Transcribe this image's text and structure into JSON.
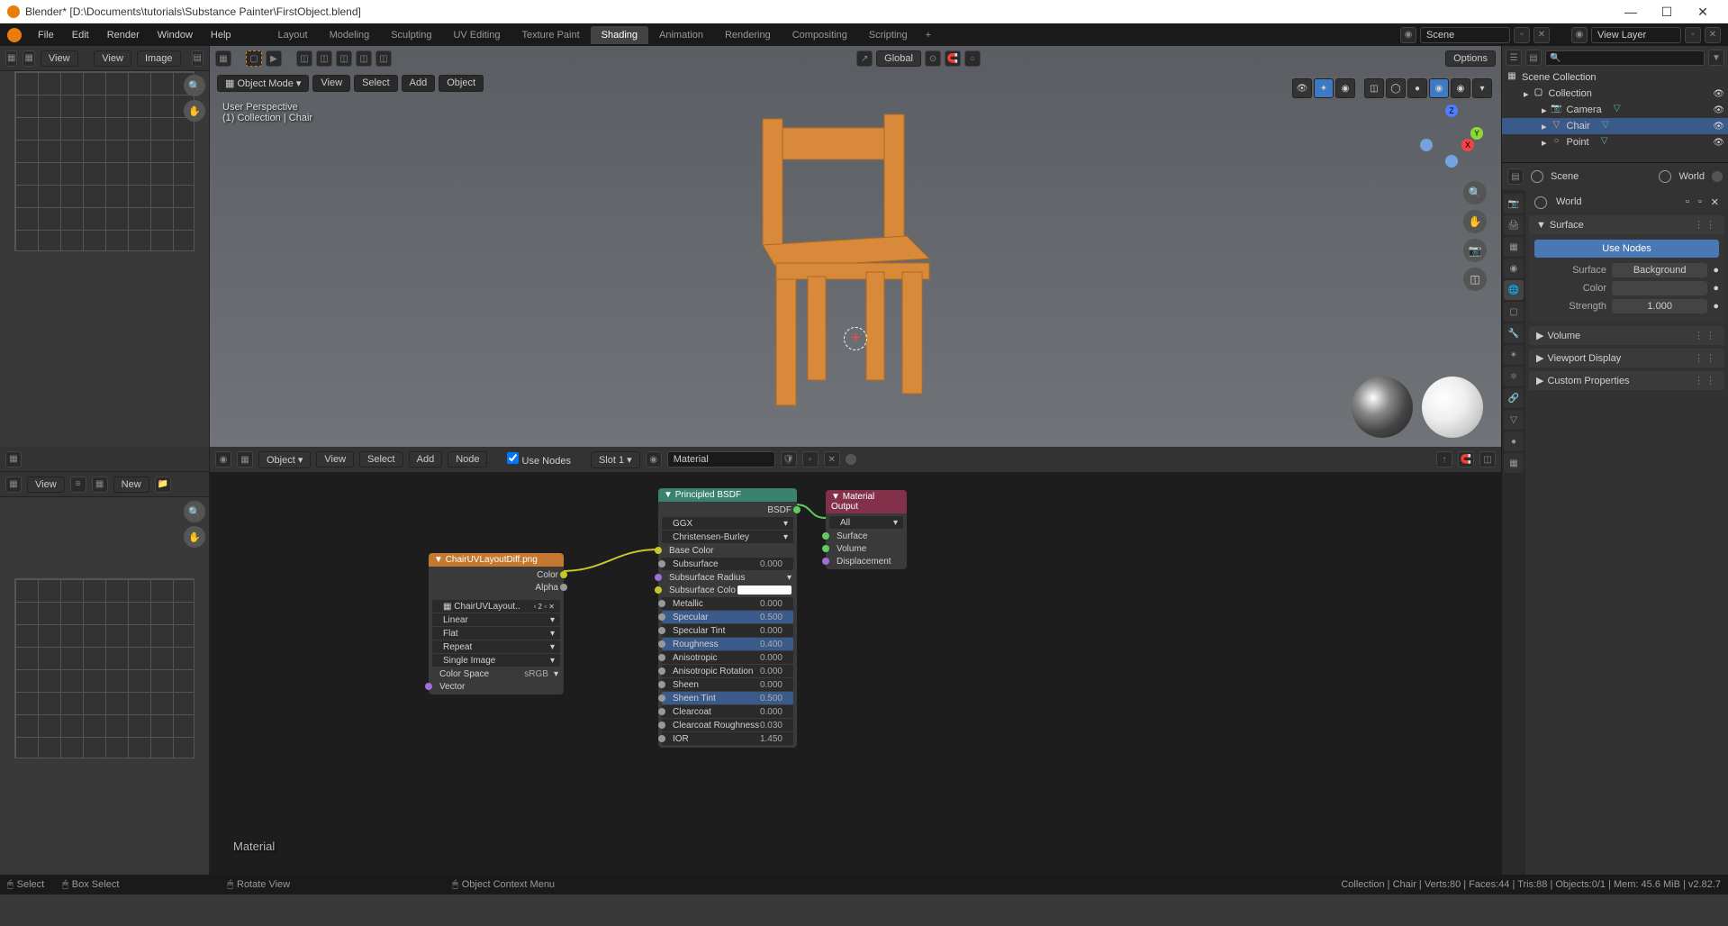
{
  "titlebar": {
    "title": "Blender* [D:\\Documents\\tutorials\\Substance Painter\\FirstObject.blend]"
  },
  "topmenu": {
    "items": [
      "File",
      "Edit",
      "Render",
      "Window",
      "Help"
    ]
  },
  "workspaces": {
    "tabs": [
      "Layout",
      "Modeling",
      "Sculpting",
      "UV Editing",
      "Texture Paint",
      "Shading",
      "Animation",
      "Rendering",
      "Compositing",
      "Scripting"
    ],
    "active": "Shading"
  },
  "scene_selector": {
    "scene": "Scene",
    "layer": "View Layer"
  },
  "left_panel": {
    "view_label": "View",
    "view_label2": "View",
    "image_label": "Image",
    "view_label3": "View",
    "new_label": "New"
  },
  "viewport": {
    "mode": "Object Mode",
    "menus": [
      "View",
      "Select",
      "Add",
      "Object"
    ],
    "orientation": "Global",
    "options_label": "Options",
    "perspective": "User Perspective",
    "context": "(1) Collection | Chair"
  },
  "node_editor": {
    "menus": [
      "Object",
      "View",
      "Select",
      "Add",
      "Node"
    ],
    "use_nodes": "Use Nodes",
    "slot": "Slot 1",
    "material": "Material",
    "material_label": "Material"
  },
  "nodes": {
    "image": {
      "title": "ChairUVLayoutDiff.png",
      "filename": "ChairUVLayout..",
      "color_label": "Color",
      "alpha_label": "Alpha",
      "interp": "Linear",
      "proj": "Flat",
      "ext": "Repeat",
      "single": "Single Image",
      "colorspace_label": "Color Space",
      "colorspace": "sRGB",
      "vector": "Vector"
    },
    "bsdf": {
      "title": "Principled BSDF",
      "output": "BSDF",
      "dist": "GGX",
      "sss": "Christensen-Burley",
      "rows": [
        {
          "lbl": "Base Color",
          "val": "",
          "type": "color",
          "socket": "yellow"
        },
        {
          "lbl": "Subsurface",
          "val": "0.000",
          "type": "slider",
          "socket": "gray"
        },
        {
          "lbl": "Subsurface Radius",
          "val": "",
          "type": "dropdown",
          "socket": "purple"
        },
        {
          "lbl": "Subsurface Colo",
          "val": "",
          "type": "colorswatch",
          "socket": "yellow"
        },
        {
          "lbl": "Metallic",
          "val": "0.000",
          "type": "slider",
          "socket": "gray"
        },
        {
          "lbl": "Specular",
          "val": "0.500",
          "type": "slider-blue",
          "socket": "gray"
        },
        {
          "lbl": "Specular Tint",
          "val": "0.000",
          "type": "slider",
          "socket": "gray"
        },
        {
          "lbl": "Roughness",
          "val": "0.400",
          "type": "slider-blue",
          "socket": "gray"
        },
        {
          "lbl": "Anisotropic",
          "val": "0.000",
          "type": "slider",
          "socket": "gray"
        },
        {
          "lbl": "Anisotropic Rotation",
          "val": "0.000",
          "type": "slider",
          "socket": "gray"
        },
        {
          "lbl": "Sheen",
          "val": "0.000",
          "type": "slider",
          "socket": "gray"
        },
        {
          "lbl": "Sheen Tint",
          "val": "0.500",
          "type": "slider-blue",
          "socket": "gray"
        },
        {
          "lbl": "Clearcoat",
          "val": "0.000",
          "type": "slider",
          "socket": "gray"
        },
        {
          "lbl": "Clearcoat Roughness",
          "val": "0.030",
          "type": "slider",
          "socket": "gray"
        },
        {
          "lbl": "IOR",
          "val": "1.450",
          "type": "slider",
          "socket": "gray"
        }
      ]
    },
    "output": {
      "title": "Material Output",
      "all": "All",
      "surface": "Surface",
      "volume": "Volume",
      "displacement": "Displacement"
    }
  },
  "outliner": {
    "collection": "Scene Collection",
    "items": [
      {
        "name": "Collection",
        "indent": 1,
        "icon": "collection"
      },
      {
        "name": "Camera",
        "indent": 2,
        "icon": "camera"
      },
      {
        "name": "Chair",
        "indent": 2,
        "icon": "mesh",
        "selected": true
      },
      {
        "name": "Point",
        "indent": 2,
        "icon": "light"
      }
    ]
  },
  "properties": {
    "scene": "Scene",
    "world": "World",
    "world2": "World",
    "surface_panel": "Surface",
    "use_nodes_btn": "Use Nodes",
    "surface_label": "Surface",
    "surface_val": "Background",
    "color_label": "Color",
    "strength_label": "Strength",
    "strength_val": "1.000",
    "volume_panel": "Volume",
    "viewport_panel": "Viewport Display",
    "custom_panel": "Custom Properties"
  },
  "status": {
    "select": "Select",
    "box_select": "Box Select",
    "rotate": "Rotate View",
    "context": "Object Context Menu",
    "stats": "Collection | Chair | Verts:80 | Faces:44 | Tris:88 | Objects:0/1 | Mem: 45.6 MiB | v2.82.7"
  }
}
